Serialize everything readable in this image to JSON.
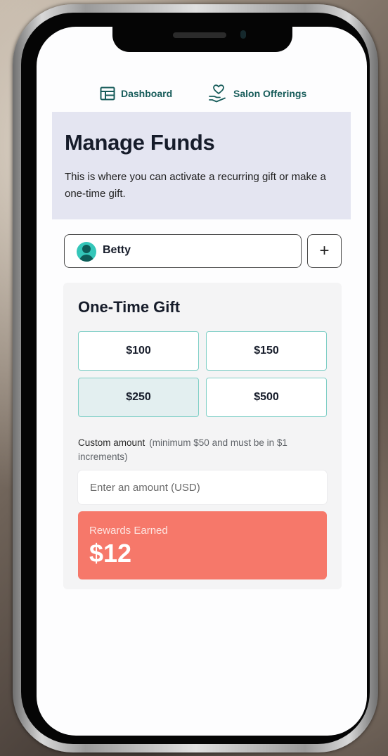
{
  "nav": {
    "dashboard": {
      "label": "Dashboard",
      "icon": "dashboard-layout-icon"
    },
    "offerings": {
      "label": "Salon Offerings",
      "icon": "hand-heart-icon"
    }
  },
  "hero": {
    "title": "Manage Funds",
    "description": "This is where you can activate a recurring gift or make a one-time gift."
  },
  "profile": {
    "name": "Betty",
    "add_label": "+"
  },
  "gift": {
    "title": "One-Time Gift",
    "amounts": [
      "$100",
      "$150",
      "$250",
      "$500"
    ],
    "selected_amount": "$250",
    "custom_label": "Custom amount",
    "custom_hint": "(minimum $50 and must be in $1 increments)",
    "custom_placeholder": "Enter an amount (USD)",
    "rewards_label": "Rewards Earned",
    "rewards_value": "$12"
  },
  "colors": {
    "accent": "#175c5a",
    "hero_bg": "#e4e5f1",
    "rewards_bg": "#f6786a",
    "selected_amount_bg": "#e3eff0",
    "amount_border": "#7fcfc6"
  }
}
